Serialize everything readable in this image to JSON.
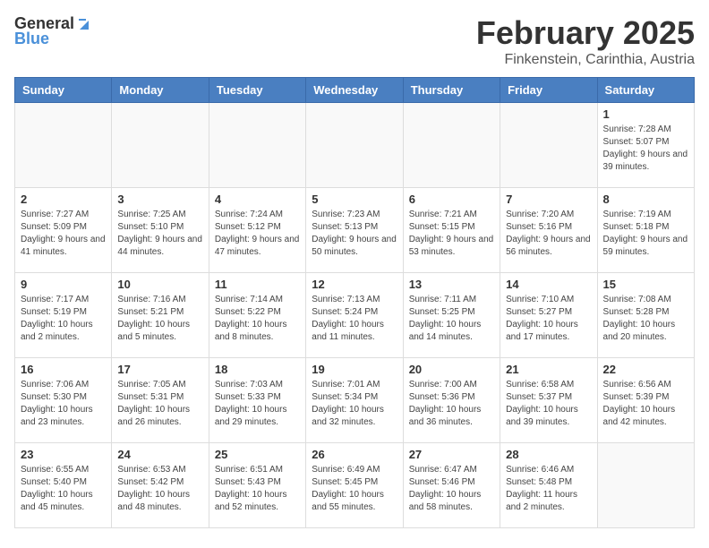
{
  "logo": {
    "general": "General",
    "blue": "Blue"
  },
  "header": {
    "title": "February 2025",
    "subtitle": "Finkenstein, Carinthia, Austria"
  },
  "calendar": {
    "days_of_week": [
      "Sunday",
      "Monday",
      "Tuesday",
      "Wednesday",
      "Thursday",
      "Friday",
      "Saturday"
    ],
    "weeks": [
      [
        {
          "day": "",
          "info": ""
        },
        {
          "day": "",
          "info": ""
        },
        {
          "day": "",
          "info": ""
        },
        {
          "day": "",
          "info": ""
        },
        {
          "day": "",
          "info": ""
        },
        {
          "day": "",
          "info": ""
        },
        {
          "day": "1",
          "info": "Sunrise: 7:28 AM\nSunset: 5:07 PM\nDaylight: 9 hours and 39 minutes."
        }
      ],
      [
        {
          "day": "2",
          "info": "Sunrise: 7:27 AM\nSunset: 5:09 PM\nDaylight: 9 hours and 41 minutes."
        },
        {
          "day": "3",
          "info": "Sunrise: 7:25 AM\nSunset: 5:10 PM\nDaylight: 9 hours and 44 minutes."
        },
        {
          "day": "4",
          "info": "Sunrise: 7:24 AM\nSunset: 5:12 PM\nDaylight: 9 hours and 47 minutes."
        },
        {
          "day": "5",
          "info": "Sunrise: 7:23 AM\nSunset: 5:13 PM\nDaylight: 9 hours and 50 minutes."
        },
        {
          "day": "6",
          "info": "Sunrise: 7:21 AM\nSunset: 5:15 PM\nDaylight: 9 hours and 53 minutes."
        },
        {
          "day": "7",
          "info": "Sunrise: 7:20 AM\nSunset: 5:16 PM\nDaylight: 9 hours and 56 minutes."
        },
        {
          "day": "8",
          "info": "Sunrise: 7:19 AM\nSunset: 5:18 PM\nDaylight: 9 hours and 59 minutes."
        }
      ],
      [
        {
          "day": "9",
          "info": "Sunrise: 7:17 AM\nSunset: 5:19 PM\nDaylight: 10 hours and 2 minutes."
        },
        {
          "day": "10",
          "info": "Sunrise: 7:16 AM\nSunset: 5:21 PM\nDaylight: 10 hours and 5 minutes."
        },
        {
          "day": "11",
          "info": "Sunrise: 7:14 AM\nSunset: 5:22 PM\nDaylight: 10 hours and 8 minutes."
        },
        {
          "day": "12",
          "info": "Sunrise: 7:13 AM\nSunset: 5:24 PM\nDaylight: 10 hours and 11 minutes."
        },
        {
          "day": "13",
          "info": "Sunrise: 7:11 AM\nSunset: 5:25 PM\nDaylight: 10 hours and 14 minutes."
        },
        {
          "day": "14",
          "info": "Sunrise: 7:10 AM\nSunset: 5:27 PM\nDaylight: 10 hours and 17 minutes."
        },
        {
          "day": "15",
          "info": "Sunrise: 7:08 AM\nSunset: 5:28 PM\nDaylight: 10 hours and 20 minutes."
        }
      ],
      [
        {
          "day": "16",
          "info": "Sunrise: 7:06 AM\nSunset: 5:30 PM\nDaylight: 10 hours and 23 minutes."
        },
        {
          "day": "17",
          "info": "Sunrise: 7:05 AM\nSunset: 5:31 PM\nDaylight: 10 hours and 26 minutes."
        },
        {
          "day": "18",
          "info": "Sunrise: 7:03 AM\nSunset: 5:33 PM\nDaylight: 10 hours and 29 minutes."
        },
        {
          "day": "19",
          "info": "Sunrise: 7:01 AM\nSunset: 5:34 PM\nDaylight: 10 hours and 32 minutes."
        },
        {
          "day": "20",
          "info": "Sunrise: 7:00 AM\nSunset: 5:36 PM\nDaylight: 10 hours and 36 minutes."
        },
        {
          "day": "21",
          "info": "Sunrise: 6:58 AM\nSunset: 5:37 PM\nDaylight: 10 hours and 39 minutes."
        },
        {
          "day": "22",
          "info": "Sunrise: 6:56 AM\nSunset: 5:39 PM\nDaylight: 10 hours and 42 minutes."
        }
      ],
      [
        {
          "day": "23",
          "info": "Sunrise: 6:55 AM\nSunset: 5:40 PM\nDaylight: 10 hours and 45 minutes."
        },
        {
          "day": "24",
          "info": "Sunrise: 6:53 AM\nSunset: 5:42 PM\nDaylight: 10 hours and 48 minutes."
        },
        {
          "day": "25",
          "info": "Sunrise: 6:51 AM\nSunset: 5:43 PM\nDaylight: 10 hours and 52 minutes."
        },
        {
          "day": "26",
          "info": "Sunrise: 6:49 AM\nSunset: 5:45 PM\nDaylight: 10 hours and 55 minutes."
        },
        {
          "day": "27",
          "info": "Sunrise: 6:47 AM\nSunset: 5:46 PM\nDaylight: 10 hours and 58 minutes."
        },
        {
          "day": "28",
          "info": "Sunrise: 6:46 AM\nSunset: 5:48 PM\nDaylight: 11 hours and 2 minutes."
        },
        {
          "day": "",
          "info": ""
        }
      ]
    ]
  }
}
